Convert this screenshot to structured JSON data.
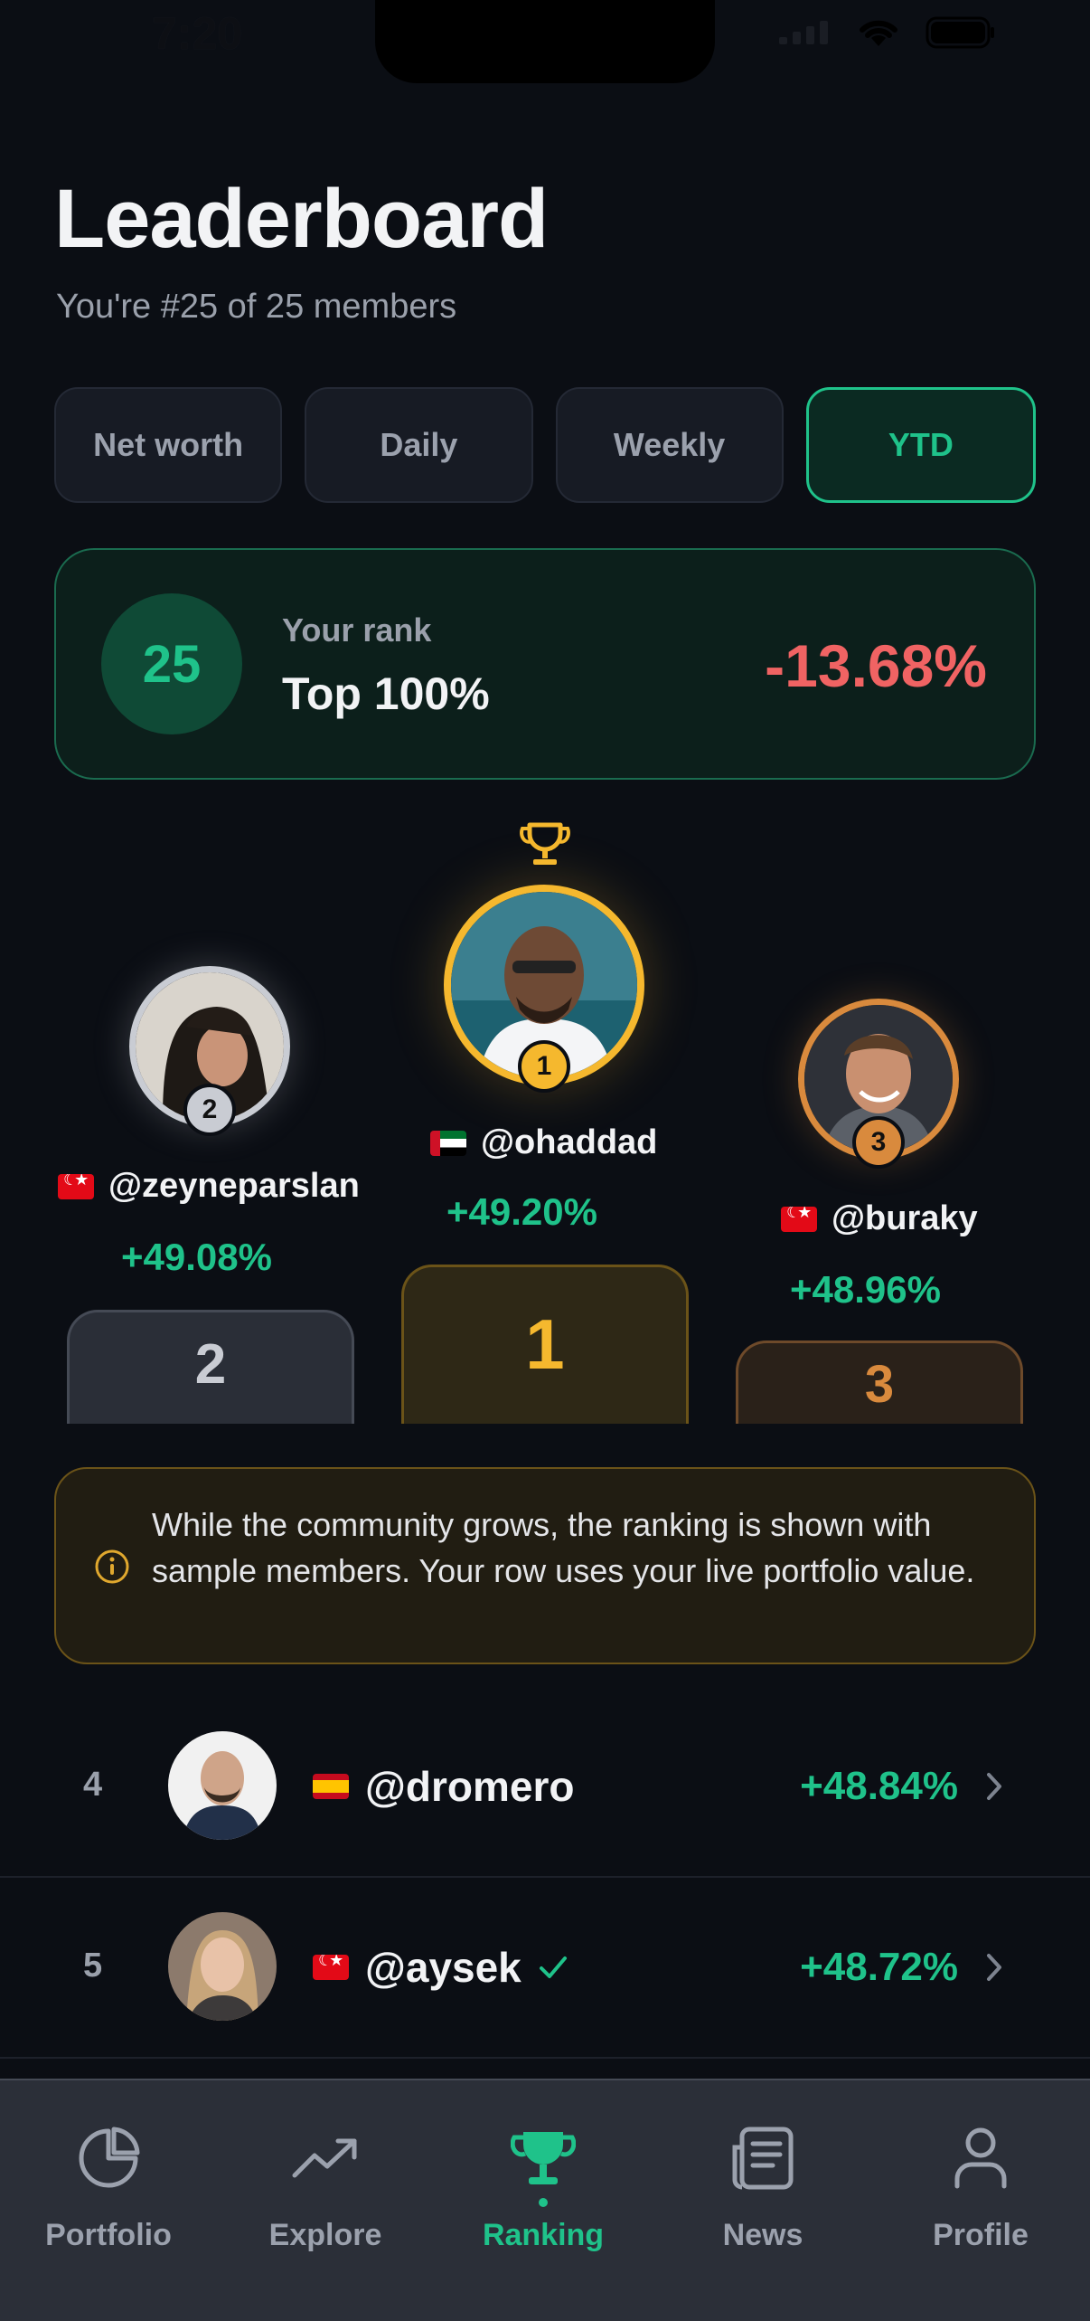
{
  "status": {
    "time": "7:20"
  },
  "header": {
    "title": "Leaderboard",
    "subtitle": "You're #25 of 25 members"
  },
  "tabs": [
    {
      "label": "Net worth",
      "active": false
    },
    {
      "label": "Daily",
      "active": false
    },
    {
      "label": "Weekly",
      "active": false
    },
    {
      "label": "YTD",
      "active": true
    }
  ],
  "rank_card": {
    "rank": "25",
    "label": "Your rank",
    "top": "Top 100%",
    "change": "-13.68%"
  },
  "podium": {
    "first": {
      "place": "1",
      "handle": "@ohaddad",
      "flag": "AE",
      "change": "+49.20%"
    },
    "second": {
      "place": "2",
      "handle": "@zeyneparslan",
      "flag": "TR",
      "change": "+49.08%"
    },
    "third": {
      "place": "3",
      "handle": "@buraky",
      "flag": "TR",
      "change": "+48.96%"
    }
  },
  "banner": {
    "text": "While the community grows, the ranking is shown with sample members. Your row uses your live portfolio value."
  },
  "list": [
    {
      "rank": "4",
      "handle": "@dromero",
      "flag": "ES",
      "change": "+48.84%",
      "verified": false
    },
    {
      "rank": "5",
      "handle": "@aysek",
      "flag": "TR",
      "change": "+48.72%",
      "verified": true
    }
  ],
  "nav": [
    {
      "label": "Portfolio",
      "icon": "pie-chart-icon",
      "active": false
    },
    {
      "label": "Explore",
      "icon": "trending-up-icon",
      "active": false
    },
    {
      "label": "Ranking",
      "icon": "trophy-icon",
      "active": true
    },
    {
      "label": "News",
      "icon": "newspaper-icon",
      "active": false
    },
    {
      "label": "Profile",
      "icon": "person-icon",
      "active": false
    }
  ],
  "colors": {
    "accent": "#1fc28a",
    "negative": "#f06363",
    "gold": "#f5b82e",
    "silver": "#c9ccd3",
    "bronze": "#d98a3d"
  }
}
